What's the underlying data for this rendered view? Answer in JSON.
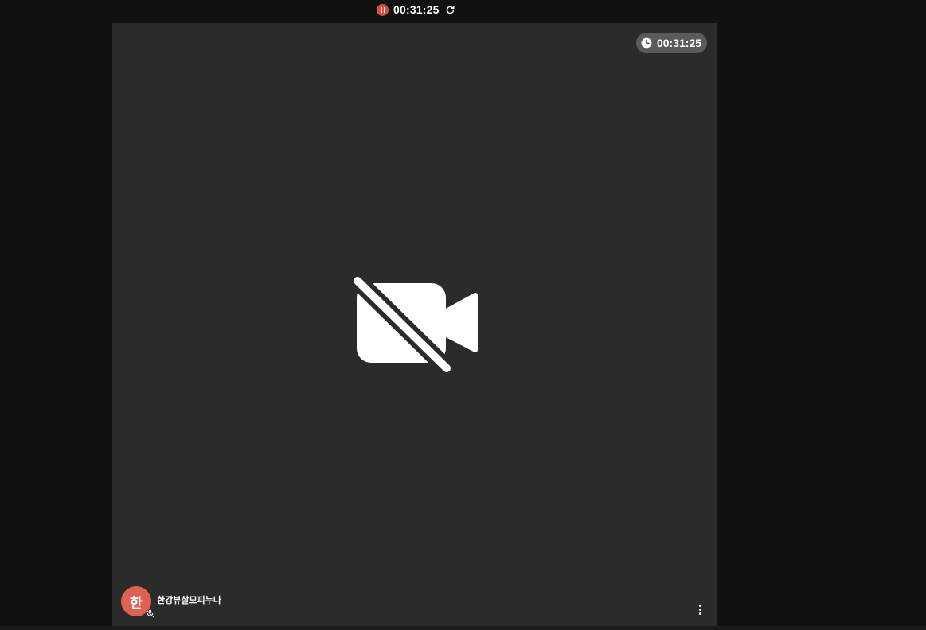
{
  "recording": {
    "elapsed": "00:31:25",
    "status_color": "#e04b3c"
  },
  "stage": {
    "timer": "00:31:25",
    "video_state_icon": "video-off-icon"
  },
  "participant": {
    "initial": "한",
    "name": "한강뷰살모피누나",
    "avatar_color": "#e06052",
    "mic_icon": "mic-off-icon"
  },
  "controls": {
    "more_icon": "more-vertical-icon",
    "refresh_icon": "refresh-icon",
    "pause_icon": "pause-icon"
  }
}
